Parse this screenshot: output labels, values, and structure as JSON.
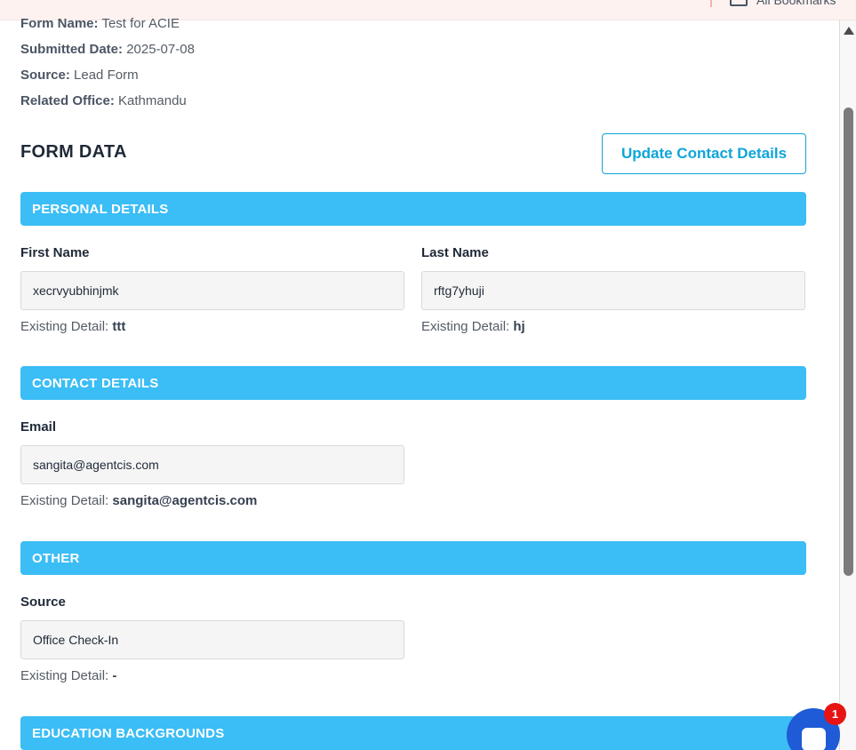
{
  "topbar": {
    "bookmarks_label": "All Bookmarks"
  },
  "meta": [
    {
      "label": "Form Name:",
      "value": "Test for ACIE"
    },
    {
      "label": "Submitted Date:",
      "value": "2025-07-08"
    },
    {
      "label": "Source:",
      "value": "Lead Form"
    },
    {
      "label": "Related Office:",
      "value": "Kathmandu"
    }
  ],
  "form_data": {
    "title": "FORM DATA",
    "update_button": "Update Contact Details"
  },
  "sections": {
    "personal": {
      "title": "PERSONAL DETAILS",
      "first_name": {
        "label": "First Name",
        "value": "xecrvyubhinjmk",
        "existing_label": "Existing Detail:",
        "existing_value": "ttt"
      },
      "last_name": {
        "label": "Last Name",
        "value": "rftg7yhuji",
        "existing_label": "Existing Detail:",
        "existing_value": "hj"
      }
    },
    "contact": {
      "title": "CONTACT DETAILS",
      "email": {
        "label": "Email",
        "value": "sangita@agentcis.com",
        "existing_label": "Existing Detail:",
        "existing_value": "sangita@agentcis.com"
      }
    },
    "other": {
      "title": "OTHER",
      "source": {
        "label": "Source",
        "value": "Office Check-In",
        "existing_label": "Existing Detail:",
        "existing_value": "-"
      }
    },
    "education": {
      "title": "EDUCATION BACKGROUNDS"
    }
  },
  "chat": {
    "badge_count": "1"
  },
  "colors": {
    "accent": "#3bbdf5",
    "button": "#0ea5d9",
    "chat": "#1f5bd6",
    "badge": "#e81313"
  }
}
